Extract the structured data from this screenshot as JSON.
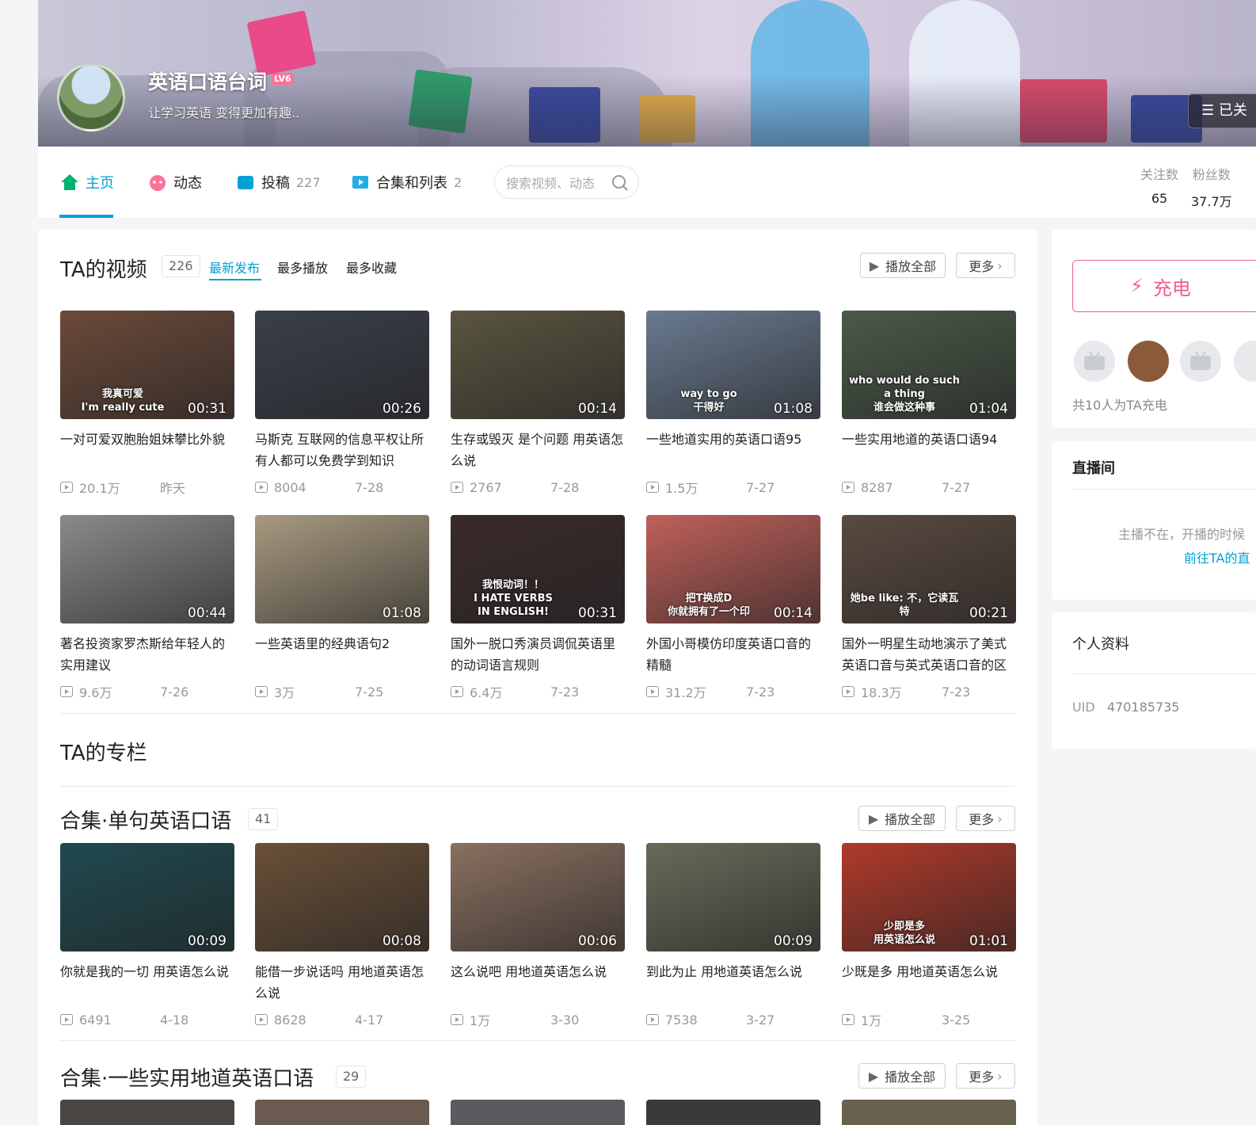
{
  "header": {
    "username": "英语口语台词",
    "level": "LV6",
    "sign": "让学习英语 变得更加有趣..",
    "follow_btn": "已关"
  },
  "nav": {
    "items": [
      {
        "label": "主页",
        "count": ""
      },
      {
        "label": "动态",
        "count": ""
      },
      {
        "label": "投稿",
        "count": "227"
      },
      {
        "label": "合集和列表",
        "count": "2"
      }
    ],
    "search_placeholder": "搜索视频、动态",
    "stats": [
      {
        "label": "关注数",
        "value": "65"
      },
      {
        "label": "粉丝数",
        "value": "37.7万"
      }
    ]
  },
  "videos": {
    "title": "TA的视频",
    "count": "226",
    "tabs": [
      "最新发布",
      "最多播放",
      "最多收藏"
    ],
    "play_all": "播放全部",
    "more": "更多",
    "items": [
      {
        "title": "一对可爱双胞胎姐妹攀比外貌",
        "duration": "00:31",
        "views": "20.1万",
        "date": "昨天",
        "overlay": "我真可爱\nI'm really cute",
        "color": "#6b4a3a"
      },
      {
        "title": "马斯克 互联网的信息平权让所有人都可以免费学到知识",
        "duration": "00:26",
        "views": "8004",
        "date": "7-28",
        "overlay": "",
        "color": "#3a3f4a"
      },
      {
        "title": "生存或毁灭 是个问题 用英语怎么说",
        "duration": "00:14",
        "views": "2767",
        "date": "7-28",
        "overlay": "",
        "color": "#5a5540"
      },
      {
        "title": "一些地道实用的英语口语95",
        "duration": "01:08",
        "views": "1.5万",
        "date": "7-27",
        "overlay": "way to go\n干得好",
        "color": "#6a7a90"
      },
      {
        "title": "一些实用地道的英语口语94",
        "duration": "01:04",
        "views": "8287",
        "date": "7-27",
        "overlay": "who would do such a thing\n谁会做这种事",
        "color": "#4a5a48"
      },
      {
        "title": "著名投资家罗杰斯给年轻人的实用建议",
        "duration": "00:44",
        "views": "9.6万",
        "date": "7-26",
        "overlay": "",
        "color": "#8a8a8a"
      },
      {
        "title": "一些英语里的经典语句2",
        "duration": "01:08",
        "views": "3万",
        "date": "7-25",
        "overlay": "",
        "color": "#a89a80"
      },
      {
        "title": "国外一脱口秀演员调侃英语里的动词语言规则",
        "duration": "00:31",
        "views": "6.4万",
        "date": "7-23",
        "overlay": "我恨动词！！\nI HATE VERBS\nIN ENGLISH!",
        "color": "#3a2a2a"
      },
      {
        "title": "外国小哥模仿印度英语口音的精髓",
        "duration": "00:14",
        "views": "31.2万",
        "date": "7-23",
        "overlay": "把T换成D\n你就拥有了一个印",
        "color": "#c0605a"
      },
      {
        "title": "国外一明星生动地演示了美式英语口音与英式英语口音的区",
        "duration": "00:21",
        "views": "18.3万",
        "date": "7-23",
        "overlay": "她be like: 不，它读瓦特",
        "color": "#5a4a40"
      }
    ]
  },
  "column": {
    "title": "TA的专栏"
  },
  "collection1": {
    "title": "合集·单句英语口语",
    "count": "41",
    "play_all": "播放全部",
    "more": "更多",
    "items": [
      {
        "title": "你就是我的一切 用英语怎么说",
        "duration": "00:09",
        "views": "6491",
        "date": "4-18",
        "overlay": "",
        "color": "#1f4a50"
      },
      {
        "title": "能借一步说话吗 用地道英语怎么说",
        "duration": "00:08",
        "views": "8628",
        "date": "4-17",
        "overlay": "",
        "color": "#6a5038"
      },
      {
        "title": "这么说吧 用地道英语怎么说",
        "duration": "00:06",
        "views": "1万",
        "date": "3-30",
        "overlay": "",
        "color": "#8a7060"
      },
      {
        "title": "到此为止 用地道英语怎么说",
        "duration": "00:09",
        "views": "7538",
        "date": "3-27",
        "overlay": "",
        "color": "#6a6a5a"
      },
      {
        "title": "少既是多 用地道英语怎么说",
        "duration": "01:01",
        "views": "1万",
        "date": "3-25",
        "overlay": "少即是多\n用英语怎么说",
        "color": "#b03a2a"
      }
    ]
  },
  "collection2": {
    "title": "合集·一些实用地道英语口语",
    "count": "29",
    "play_all": "播放全部",
    "more": "更多"
  },
  "sidebar": {
    "charge_label": "充电",
    "charge_count": "共10人为TA充电",
    "live_title": "直播间",
    "live_text": "主播不在，开播的时候",
    "live_link": "前往TA的直",
    "profile_title": "个人资料",
    "uid_label": "UID",
    "uid_value": "470185735"
  },
  "colors": {
    "accent": "#00a1d6",
    "pink": "#fb7299",
    "charge": "#f25d8e"
  }
}
